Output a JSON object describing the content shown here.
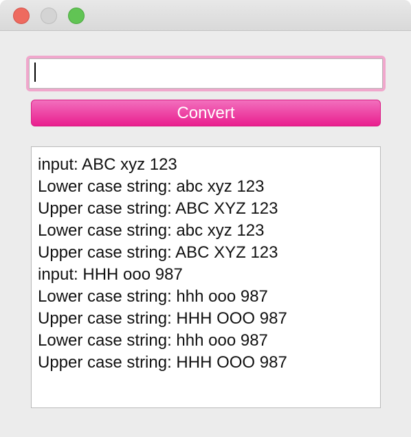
{
  "window": {
    "traffic_lights": {
      "close_color": "#ee6a5f",
      "minimize_color": "#d4d4d4",
      "zoom_color": "#61c454"
    }
  },
  "converter": {
    "input_value": "",
    "input_placeholder": "",
    "convert_label": "Convert",
    "accent_color": "#e91e8e",
    "output_lines": [
      "input: ABC xyz 123",
      "Lower case string: abc xyz 123",
      "Upper case string: ABC XYZ 123",
      "Lower case string: abc xyz 123",
      "Upper case string: ABC XYZ 123",
      "input: HHH ooo 987",
      "Lower case string: hhh ooo 987",
      "Upper case string: HHH OOO 987",
      "Lower case string: hhh ooo 987",
      "Upper case string: HHH OOO 987"
    ]
  }
}
